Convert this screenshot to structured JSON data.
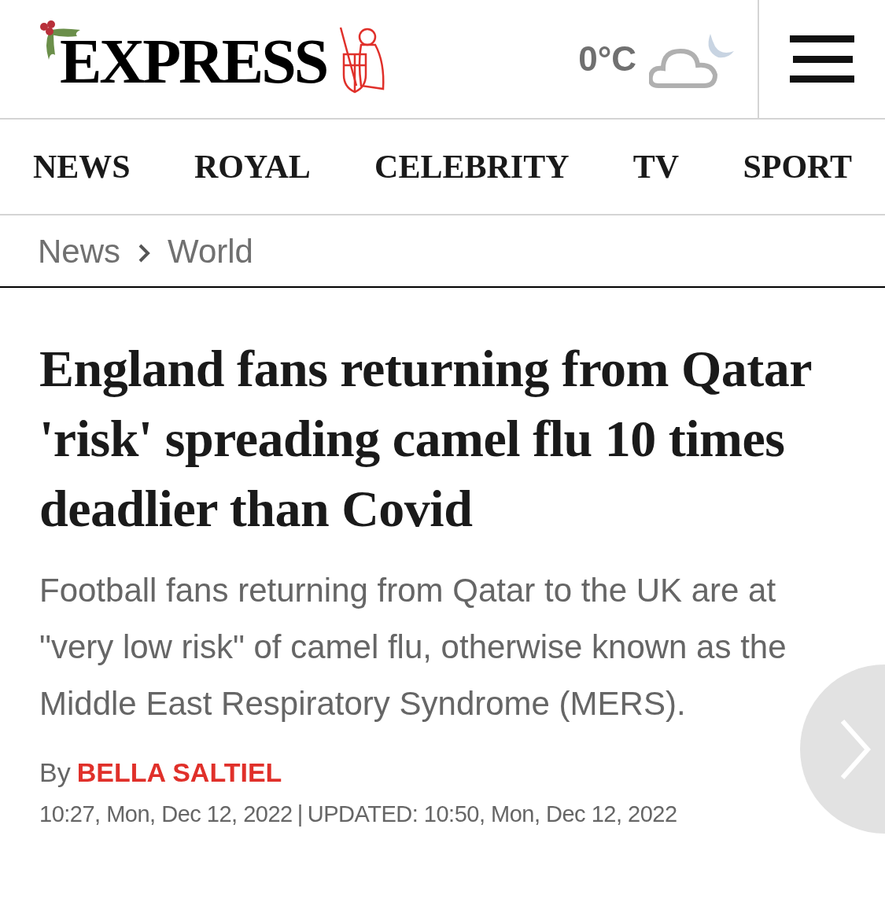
{
  "header": {
    "logo": "EXPRESS",
    "temperature": "0°C"
  },
  "nav": [
    {
      "label": "NEWS"
    },
    {
      "label": "ROYAL"
    },
    {
      "label": "CELEBRITY"
    },
    {
      "label": "TV"
    },
    {
      "label": "SPORT"
    }
  ],
  "breadcrumb": [
    "News",
    "World"
  ],
  "article": {
    "headline": "England fans returning from Qatar 'risk' spreading camel flu 10 times deadlier than Covid",
    "standfirst": "Football fans returning from Qatar to the UK are at \"very low risk\" of camel flu, otherwise known as the Middle East Respiratory Syndrome (MERS).",
    "byline_prefix": "By",
    "author": "BELLA SALTIEL",
    "published": "10:27, Mon, Dec 12, 2022",
    "separator": "|",
    "updated": "UPDATED: 10:50, Mon, Dec 12, 2022"
  }
}
